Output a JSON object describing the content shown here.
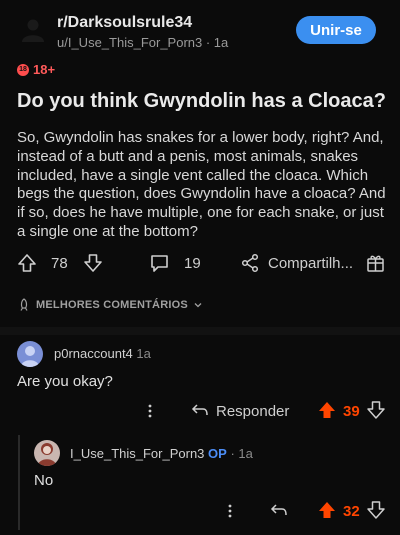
{
  "post": {
    "subreddit": "r/Darksoulsrule34",
    "user_line": "u/I_Use_This_For_Porn3 · 1a",
    "join_label": "Unir-se",
    "nsfw_badge": "18+",
    "nsfw_icon_text": "18",
    "title": "Do you think Gwyndolin has a Cloaca?",
    "body": "So, Gwyndolin has snakes for a lower body, right? And, instead of a butt and a penis, most animals, snakes included, have a single vent called the cloaca. Which begs the question, does Gwyndolin have a cloaca? And if so, does he have multiple, one for each snake, or just a single one at the bottom?",
    "upvotes": "78",
    "comments_count": "19",
    "share_label": "Compartilh..."
  },
  "sort_label": "MELHORES COMENTÁRIOS",
  "comments": [
    {
      "author": "p0rnaccount4",
      "age": "1a",
      "body": "Are you okay?",
      "reply_label": "Responder",
      "score": "39"
    },
    {
      "author": "I_Use_This_For_Porn3",
      "op_badge": "OP",
      "age": "· 1a",
      "body": "No",
      "score": "32"
    }
  ],
  "colors": {
    "accent": "#3b8ff0",
    "upvoted": "#ff4500",
    "nsfw": "#ff4d4d",
    "op": "#4c8df6"
  }
}
